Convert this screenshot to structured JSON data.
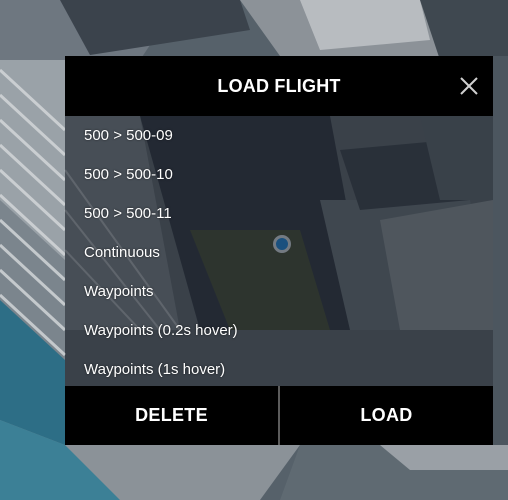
{
  "dialog": {
    "title": "LOAD FLIGHT",
    "close_icon": "close-icon"
  },
  "flights": [
    {
      "label": "500 > 500-09"
    },
    {
      "label": "500 > 500-10"
    },
    {
      "label": "500 > 500-11"
    },
    {
      "label": "Continuous"
    },
    {
      "label": "Waypoints"
    },
    {
      "label": "Waypoints (0.2s hover)"
    },
    {
      "label": "Waypoints (1s hover)"
    }
  ],
  "footer": {
    "delete_label": "DELETE",
    "load_label": "LOAD"
  },
  "map": {
    "location_marker_color": "#1f7bc4"
  }
}
